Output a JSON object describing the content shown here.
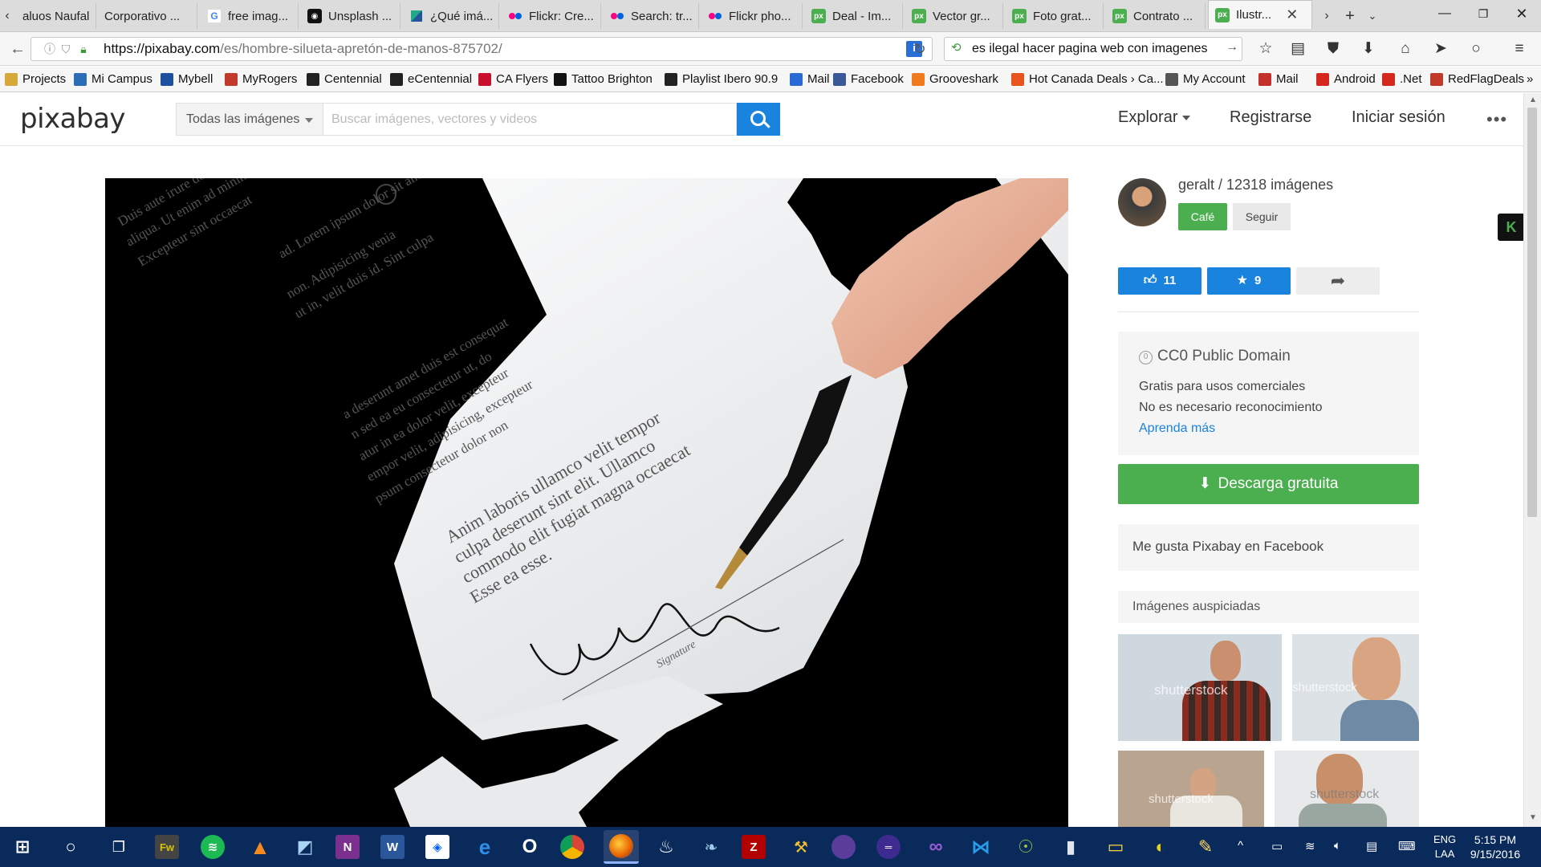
{
  "browser": {
    "tabs": [
      {
        "title": "aluos Naufal",
        "icon": "none"
      },
      {
        "title": "Corporativo ...",
        "icon": "none"
      },
      {
        "title": "free imag...",
        "icon": "google"
      },
      {
        "title": "Unsplash ...",
        "icon": "camera"
      },
      {
        "title": "¿Qué imá...",
        "icon": "kite"
      },
      {
        "title": "Flickr: Cre...",
        "icon": "flickr"
      },
      {
        "title": "Search: tr...",
        "icon": "flickr"
      },
      {
        "title": "Flickr pho...",
        "icon": "flickr"
      },
      {
        "title": "Deal - Im...",
        "icon": "px"
      },
      {
        "title": "Vector gr...",
        "icon": "px"
      },
      {
        "title": "Foto grat...",
        "icon": "px"
      },
      {
        "title": "Contrato ...",
        "icon": "px"
      },
      {
        "title": "Ilustr...",
        "icon": "px"
      }
    ],
    "url_domain": "https://pixabay.com",
    "url_path": "/es/hombre-silueta-apretón-de-manos-875702/",
    "search_text": "es ilegal hacer pagina web con imagenes",
    "bookmarks": [
      "Projects",
      "Mi Campus",
      "Mybell",
      "MyRogers",
      "Centennial",
      "eCentennial",
      "CA Flyers",
      "Tattoo Brighton",
      "Playlist Ibero 90.9",
      "Mail",
      "Facebook",
      "Grooveshark",
      "Hot Canada Deals › Ca...",
      "My Account",
      "Mail",
      "Android",
      ".Net",
      "RedFlagDeals"
    ],
    "bookmark_more": "»"
  },
  "site": {
    "logo": "pixabay",
    "category": "Todas las imágenes",
    "search_placeholder": "Buscar imágenes, vectores y videos",
    "nav": {
      "explore": "Explorar",
      "register": "Registrarse",
      "login": "Iniciar sesión",
      "more": "•••"
    }
  },
  "sidebar": {
    "author": "geralt / 12318 imágenes",
    "cafe": "Café",
    "follow": "Seguir",
    "likes": "11",
    "favorites": "9",
    "license_title": "CC0 Public Domain",
    "license_lines": [
      "Gratis para usos comerciales",
      "No es necesario reconocimiento"
    ],
    "learn_more": "Aprenda más",
    "download": "Descarga gratuita",
    "facebook": "Me gusta Pixabay en Facebook",
    "sponsored": "Imágenes auspiciadas",
    "watermark": "shutterstock"
  },
  "image_text": {
    "lorem_lines": [
      "Duis aute irure dolor in",
      "aliqua. Ut enim ad minim",
      "Excepteur sint occaecat",
      "ad. Lorem ipsum dolor sit amet,",
      "non. Adipisicing venia",
      "ut in, velit duis id. Sint culpa",
      "a deserunt amet duis est consequat",
      "n sed ea eu consectetur ut, do",
      "atur in ea dolor velit, excepteur",
      "empor velit, adipisicing, excepteur",
      "psum consectetur dolor non",
      "Anim laboris ullamco velit tempor",
      "culpa deserunt sint elit. Ullamco",
      "commodo elit fugiat magna occaecat",
      "Esse ea esse."
    ],
    "signature_label": "Signature"
  },
  "taskbar": {
    "lang_top": "ENG",
    "lang_bottom": "LAA",
    "time": "5:15 PM",
    "date": "9/15/2016"
  },
  "colors": {
    "pixabay_green": "#4bae4f",
    "pixabay_blue": "#1a83dd",
    "taskbar": "#0b2a5c"
  }
}
